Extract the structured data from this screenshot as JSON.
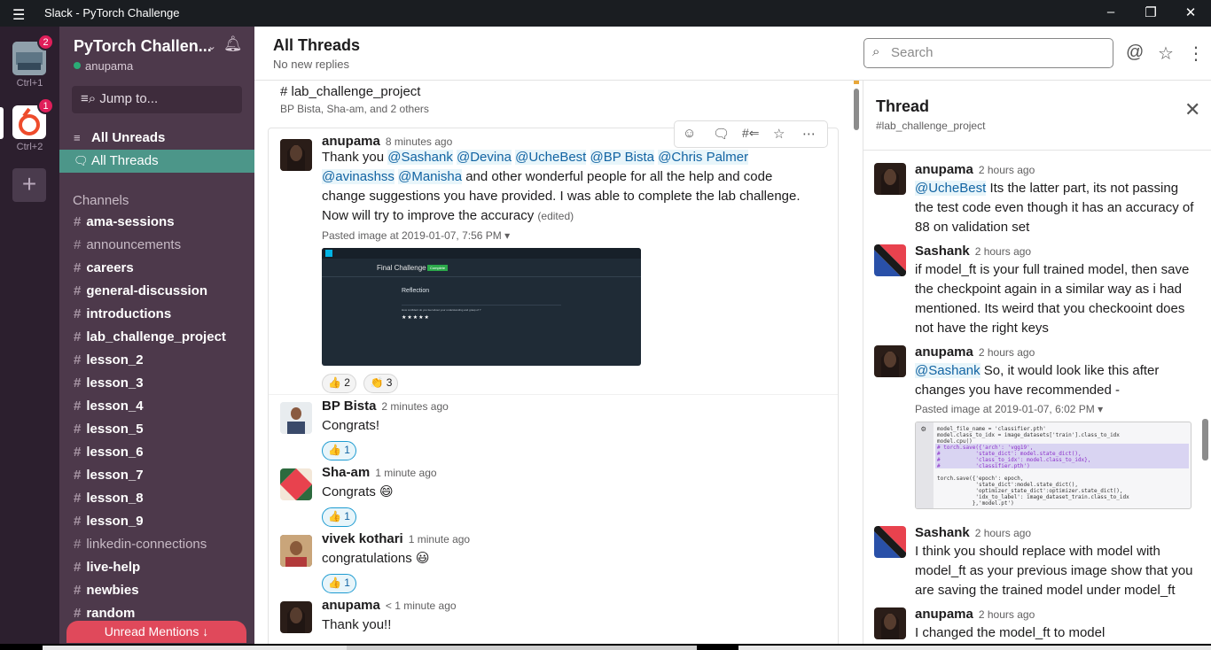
{
  "window": {
    "title": "Slack - PyTorch Challenge",
    "menu_icon": "hamburger-icon",
    "min_icon": "minimize-icon",
    "max_icon": "maximize-icon",
    "close_icon": "close-icon"
  },
  "teams": [
    {
      "shortcut": "Ctrl+1",
      "badge": "2"
    },
    {
      "shortcut": "Ctrl+2",
      "badge": "1"
    }
  ],
  "workspace": {
    "name": "PyTorch Challen...",
    "user": "anupama",
    "jump": "Jump to...",
    "unreads": "All Unreads",
    "threads": "All Threads",
    "channels_header": "Channels",
    "unread_mentions": "Unread Mentions"
  },
  "channels": [
    {
      "name": "ama-sessions",
      "bold": true
    },
    {
      "name": "announcements",
      "bold": false
    },
    {
      "name": "careers",
      "bold": true
    },
    {
      "name": "general-discussion",
      "bold": true
    },
    {
      "name": "introductions",
      "bold": true
    },
    {
      "name": "lab_challenge_project",
      "bold": true
    },
    {
      "name": "lesson_2",
      "bold": true
    },
    {
      "name": "lesson_3",
      "bold": true
    },
    {
      "name": "lesson_4",
      "bold": true
    },
    {
      "name": "lesson_5",
      "bold": true
    },
    {
      "name": "lesson_6",
      "bold": true
    },
    {
      "name": "lesson_7",
      "bold": true
    },
    {
      "name": "lesson_8",
      "bold": true
    },
    {
      "name": "lesson_9",
      "bold": true
    },
    {
      "name": "linkedin-connections",
      "bold": false
    },
    {
      "name": "live-help",
      "bold": true
    },
    {
      "name": "newbies",
      "bold": true
    },
    {
      "name": "random",
      "bold": true
    }
  ],
  "header": {
    "title": "All Threads",
    "subtitle": "No new replies",
    "search_placeholder": "Search"
  },
  "thread": {
    "channel": "#  lab_challenge_project",
    "members": "BP Bista, Sha-am, and 2 others",
    "messages": [
      {
        "author": "anupama",
        "time": "8 minutes ago",
        "mentions": [
          "@Sashank",
          "@Devina",
          "@UcheBest",
          "@BP Bista",
          "@Chris Palmer",
          "@avinashss",
          "@Manisha"
        ],
        "text": "and other wonderful people for all the help and code change suggestions you have provided. I was able to complete the lab challenge. Now will try to improve the accuracy",
        "thank_prefix": "Thank you",
        "edited": "(edited)",
        "pasted": "Pasted image at 2019-01-07, 7:56 PM",
        "reactions": [
          {
            "emoji": "👍",
            "count": "2"
          },
          {
            "emoji": "👏",
            "count": "3"
          }
        ],
        "image": {
          "heading": "Final Challenge",
          "tag": "Complete",
          "subheading": "Reflection",
          "question": "How confident do you feel about your understanding and grasp of ?",
          "stars": "★★★★★"
        }
      },
      {
        "author": "BP Bista",
        "time": "2 minutes ago",
        "text": "Congrats!",
        "reactions": [
          {
            "emoji": "👍",
            "count": "1"
          }
        ]
      },
      {
        "author": "Sha-am",
        "time": "1 minute ago",
        "text": "Congrats 😄",
        "reactions": [
          {
            "emoji": "👍",
            "count": "1"
          }
        ]
      },
      {
        "author": "vivek kothari",
        "time": "1 minute ago",
        "text": "congratulations 😃",
        "reactions": [
          {
            "emoji": "👍",
            "count": "1"
          }
        ]
      },
      {
        "author": "anupama",
        "time": "< 1 minute ago",
        "text": "Thank you!!"
      }
    ]
  },
  "panel": {
    "title": "Thread",
    "channel": "#lab_challenge_project",
    "messages": [
      {
        "author": "anupama",
        "time": "2 hours ago",
        "mention": "@UcheBest",
        "text": "Its the latter part, its not passing the test code even though it has an accuracy of 88 on validation set"
      },
      {
        "author": "Sashank",
        "time": "2 hours ago",
        "text": "if model_ft is your full trained model, then save the checkpoint again in a similar way as i had mentioned. Its weird that you checkooint does not have the right keys"
      },
      {
        "author": "anupama",
        "time": "2 hours ago",
        "mention": "@Sashank",
        "text": "So, it would look like this after changes you have recommended -",
        "pasted": "Pasted image at 2019-01-07, 6:02 PM",
        "code": [
          "model_file_name = 'classifier.pth'",
          "model.class_to_idx = image_datasets['train'].class_to_idx",
          "model.cpu()",
          "# torch.save({'arch': 'vgg19',",
          "#           'state_dict': model.state_dict(),",
          "#           'class_to_idx': model.class_to_idx},",
          "#           'classifier.pth')",
          "",
          "torch.save({'epoch': epoch,",
          "            'state_dict':model.state_dict(),",
          "            'optimizer_state_dict':optimizer.state_dict(),",
          "            'idx_to_label': image_dataset_train.class_to_idx",
          "           },'model.pt')"
        ]
      },
      {
        "author": "Sashank",
        "time": "2 hours ago",
        "text": "I think you should replace with model with model_ft as your previous image show that you are saving the trained model under model_ft"
      },
      {
        "author": "anupama",
        "time": "2 hours ago",
        "text": "I changed the model_ft to model"
      }
    ]
  },
  "colors": {
    "sidebar": "#4d394b",
    "active": "#4c9689",
    "mention": "#1264a3",
    "badge": "#e01e5a"
  }
}
